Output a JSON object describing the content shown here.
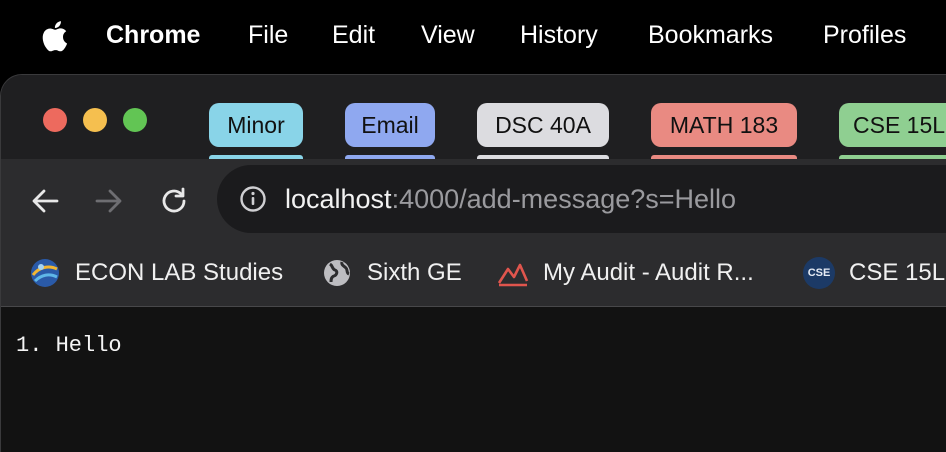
{
  "menubar": {
    "apple_icon": "apple-logo-icon",
    "items": [
      "Chrome",
      "File",
      "Edit",
      "View",
      "History",
      "Bookmarks",
      "Profiles"
    ]
  },
  "tab_groups": [
    {
      "label": "Minor",
      "color": "#89d4e8"
    },
    {
      "label": "Email",
      "color": "#8fa8f0"
    },
    {
      "label": "DSC 40A",
      "color": "#dcdce0"
    },
    {
      "label": "MATH 183",
      "color": "#e98a82"
    },
    {
      "label": "CSE 15L",
      "color": "#8fcf91"
    }
  ],
  "toolbar": {
    "back_icon": "arrow-left-icon",
    "forward_icon": "arrow-right-icon",
    "reload_icon": "reload-icon",
    "info_icon": "info-icon",
    "url_host": "localhost",
    "url_rest": ":4000/add-message?s=Hello"
  },
  "bookmarks": [
    {
      "label": "ECON LAB Studies",
      "icon": "econ-lab-globe-icon"
    },
    {
      "label": "Sixth GE",
      "icon": "globe-icon"
    },
    {
      "label": "My Audit - Audit R...",
      "icon": "audit-chart-icon"
    },
    {
      "label": "CSE 15L",
      "icon": "cse-ucsd-icon",
      "icon_text": "CSE"
    }
  ],
  "content": {
    "messages": [
      "1. Hello"
    ]
  },
  "colors": {
    "close": "#ed6a5e",
    "minimize": "#f5bf4f",
    "maximize": "#62c554"
  }
}
